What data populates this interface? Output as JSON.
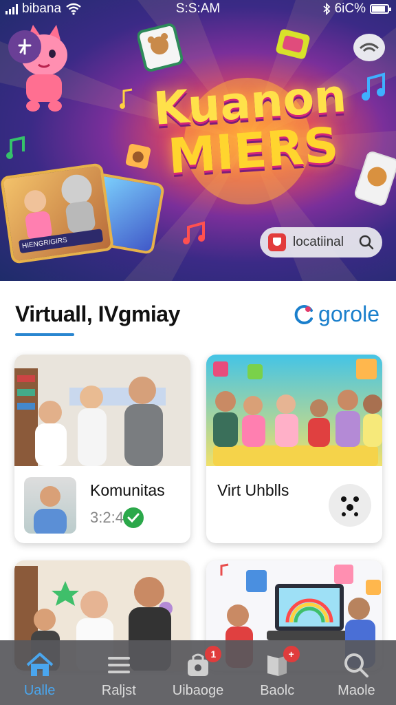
{
  "status": {
    "carrier": "bibana",
    "time": "S:S:AM",
    "battery": "6iC%",
    "battery_level": 0.85
  },
  "hero": {
    "title_line1": "Kuanon",
    "title_line2": "MIERS",
    "menu_icon": "sparkle-icon",
    "search_label": "locatiinal",
    "card_caption": "HIENGRIGIRS"
  },
  "section": {
    "title": "Virtuall, IVgmiay",
    "brand": "gorole"
  },
  "cards": [
    {
      "title": "Komunitas",
      "count": "3:2:4",
      "icon": "check-icon"
    },
    {
      "title": "Virt Uhblls",
      "icon": "face-icon"
    },
    {
      "title": ""
    },
    {
      "title": ""
    }
  ],
  "nav": {
    "items": [
      {
        "label": "Ualle",
        "icon": "home-icon",
        "active": true
      },
      {
        "label": "Raljst",
        "icon": "list-icon"
      },
      {
        "label": "Uibaoge",
        "icon": "bag-icon",
        "badge": "1"
      },
      {
        "label": "Baolc",
        "icon": "bookmark-icon",
        "badge": "+"
      },
      {
        "label": "Maole",
        "icon": "search-icon"
      }
    ]
  },
  "colors": {
    "accent": "#2a86d0",
    "nav_active": "#4aa6ee",
    "badge": "#e03c3c",
    "nav_bg": "#58585c"
  }
}
